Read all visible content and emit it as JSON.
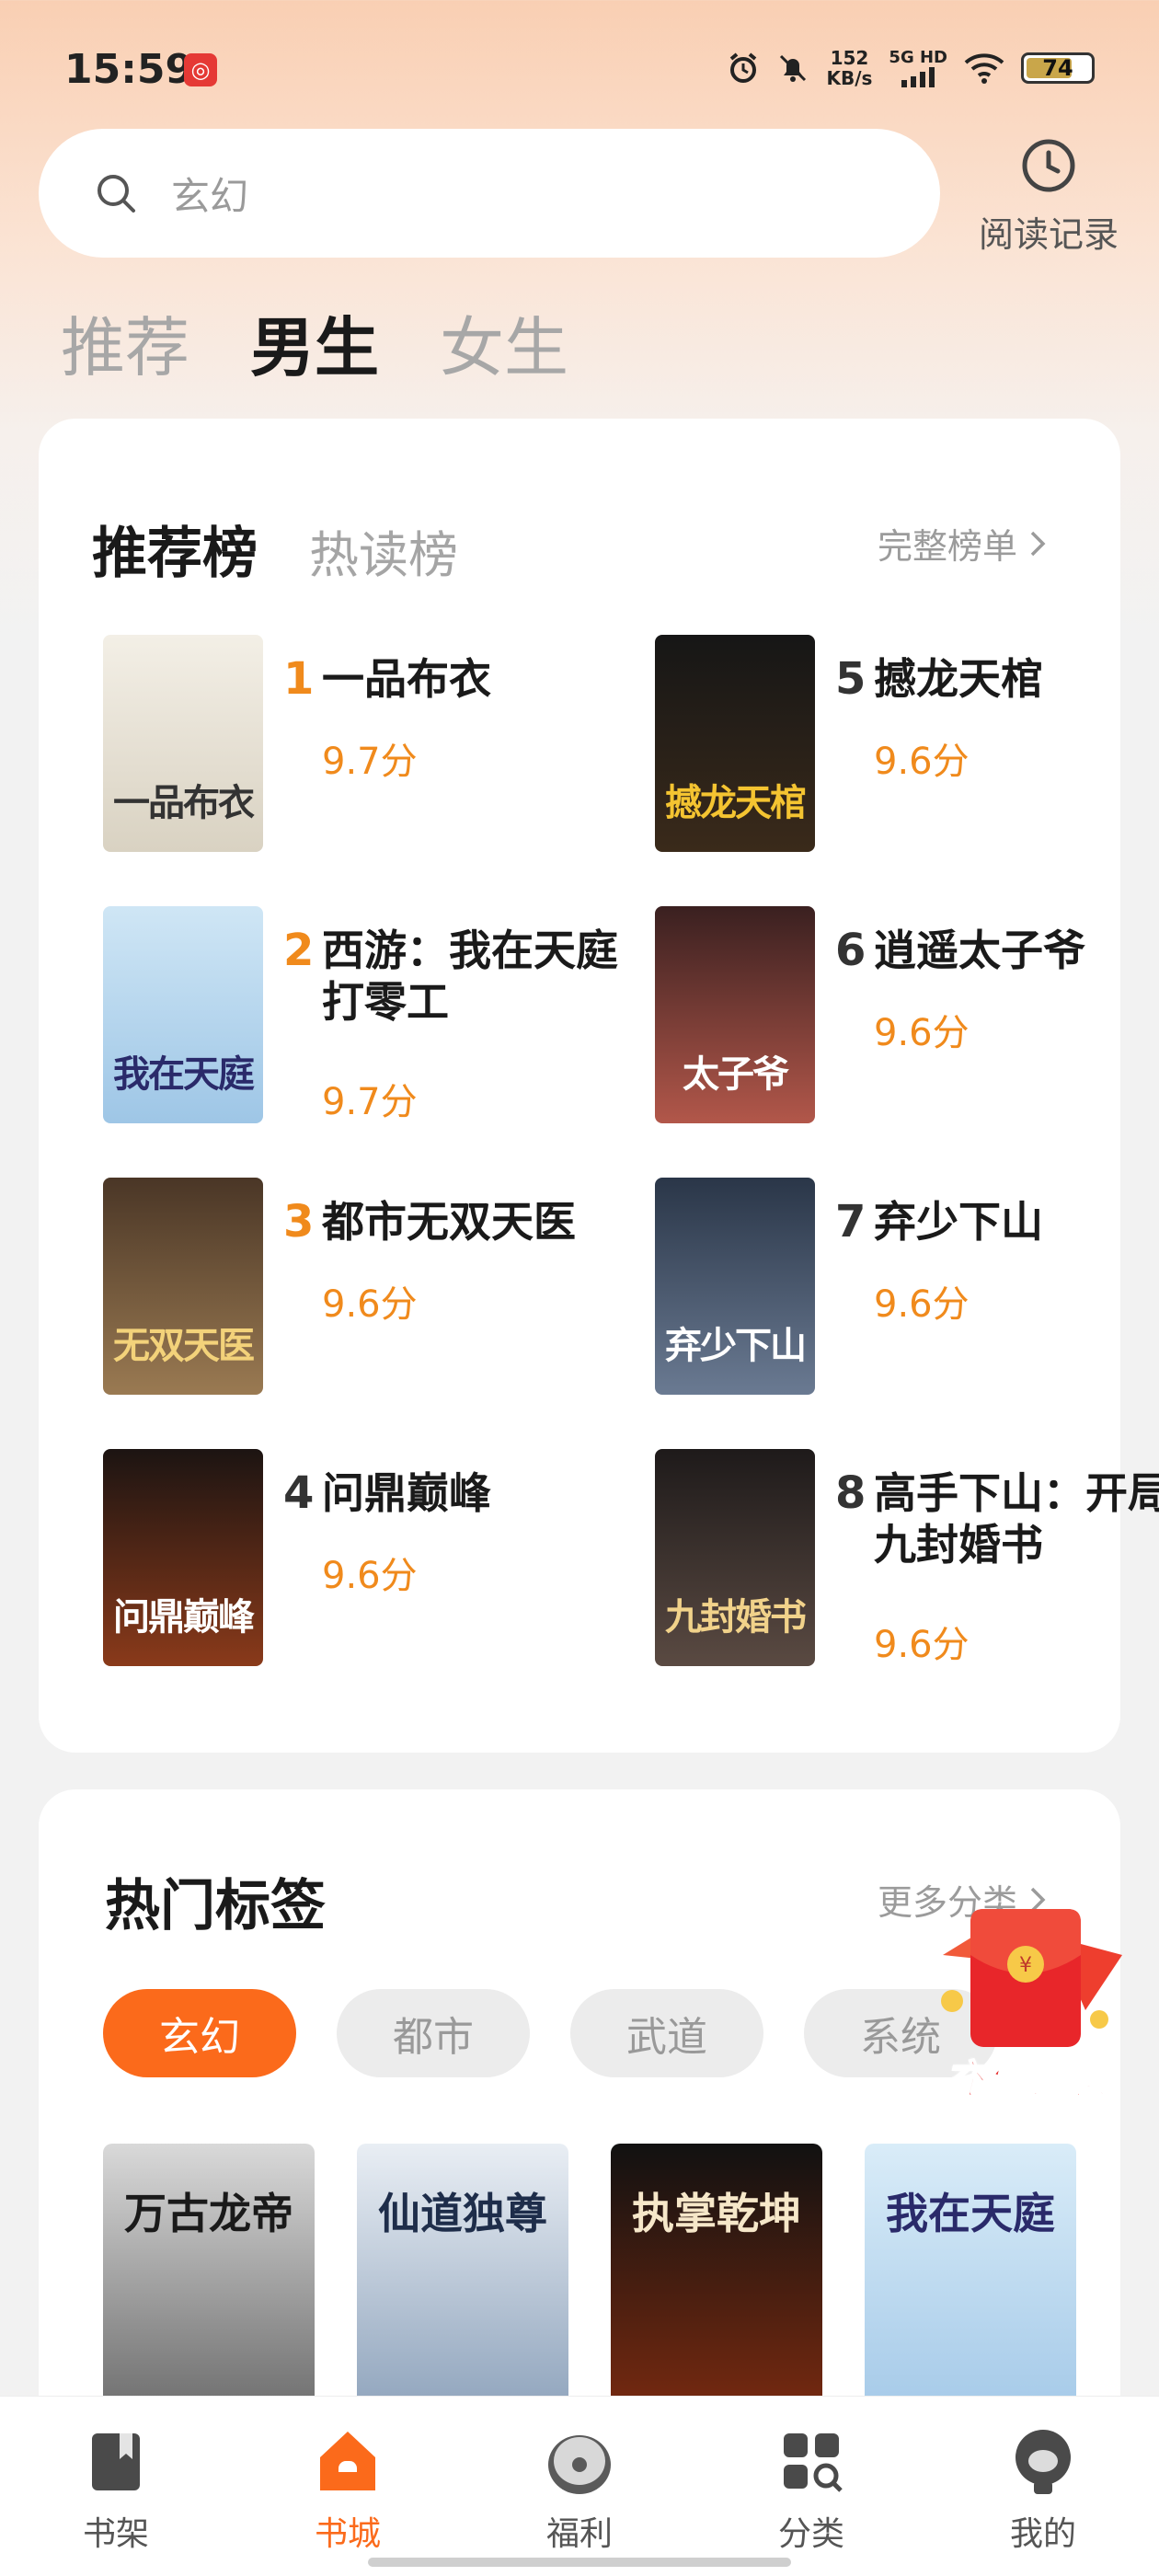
{
  "status": {
    "time": "15:59",
    "app_badge": "◎",
    "net_speed_value": "152",
    "net_speed_unit": "KB/s",
    "net_type": "5G HD",
    "battery": "74",
    "battery_level": 0.74
  },
  "search": {
    "placeholder": "玄幻"
  },
  "history": {
    "label": "阅读记录"
  },
  "gender_tabs": [
    {
      "label": "推荐",
      "active": false
    },
    {
      "label": "男生",
      "active": true
    },
    {
      "label": "女生",
      "active": false
    }
  ],
  "ranking": {
    "tabs": [
      {
        "label": "推荐榜",
        "active": true
      },
      {
        "label": "热读榜",
        "active": false
      }
    ],
    "full_list_label": "完整榜单",
    "books": [
      {
        "rank": "1",
        "title": "一品布衣",
        "score": "9.7分",
        "cover_text": "一品布衣",
        "colors": [
          "#f3efe6",
          "#d9d2c2",
          "#333333"
        ]
      },
      {
        "rank": "2",
        "title": "西游：我在天庭打零工",
        "score": "9.7分",
        "cover_text": "我在天庭",
        "colors": [
          "#cfe6f5",
          "#9ec6e6",
          "#2a2a6a"
        ]
      },
      {
        "rank": "3",
        "title": "都市无双天医",
        "score": "9.6分",
        "cover_text": "无双天医",
        "colors": [
          "#4a3626",
          "#9a7a52",
          "#f3d27a"
        ]
      },
      {
        "rank": "4",
        "title": "问鼎巅峰",
        "score": "9.6分",
        "cover_text": "问鼎巅峰",
        "colors": [
          "#1c1412",
          "#8a3a1a",
          "#ffffff"
        ]
      },
      {
        "rank": "5",
        "title": "撼龙天棺",
        "score": "9.6分",
        "cover_text": "撼龙天棺",
        "colors": [
          "#161616",
          "#3a2a1a",
          "#f4c431"
        ]
      },
      {
        "rank": "6",
        "title": "逍遥太子爷",
        "score": "9.6分",
        "cover_text": "太子爷",
        "colors": [
          "#3a2020",
          "#b2574a",
          "#ffffff"
        ]
      },
      {
        "rank": "7",
        "title": "弃少下山",
        "score": "9.6分",
        "cover_text": "弃少下山",
        "colors": [
          "#2a3648",
          "#6a7a92",
          "#ffffff"
        ]
      },
      {
        "rank": "8",
        "title": "高手下山：开局九封婚书",
        "score": "9.6分",
        "cover_text": "九封婚书",
        "colors": [
          "#1e1a1a",
          "#5a4a42",
          "#f1d28a"
        ]
      }
    ]
  },
  "hot_tags": {
    "title": "热门标签",
    "more_label": "更多分类",
    "tags": [
      {
        "label": "玄幻",
        "active": true
      },
      {
        "label": "都市",
        "active": false
      },
      {
        "label": "武道",
        "active": false
      },
      {
        "label": "系统",
        "active": false
      }
    ],
    "covers": [
      {
        "text": "万古龙帝",
        "colors": [
          "#d9d9d9",
          "#6b6b6b",
          "#1a1a1a"
        ]
      },
      {
        "text": "仙道独尊",
        "colors": [
          "#e9eef4",
          "#8da2bb",
          "#1e2d4a"
        ]
      },
      {
        "text": "执掌乾坤",
        "colors": [
          "#111111",
          "#7a2a10",
          "#f6e7c9"
        ]
      },
      {
        "text": "我在天庭",
        "colors": [
          "#d9ecf8",
          "#a4c9e8",
          "#2a2a6a"
        ]
      }
    ]
  },
  "promo": {
    "label": "充值钜惠"
  },
  "bottom_nav": [
    {
      "label": "书架",
      "icon": "bookshelf-icon",
      "active": false
    },
    {
      "label": "书城",
      "icon": "bookstore-icon",
      "active": true
    },
    {
      "label": "福利",
      "icon": "gift-icon",
      "active": false
    },
    {
      "label": "分类",
      "icon": "category-icon",
      "active": false
    },
    {
      "label": "我的",
      "icon": "profile-icon",
      "active": false
    }
  ],
  "accent_color": "#fb6a1b",
  "score_color": "#f08a1c",
  "rank_colors": [
    "#f08a1c",
    "#f08a1c",
    "#f08a1c",
    "#333333",
    "#333333",
    "#333333",
    "#333333",
    "#333333"
  ]
}
